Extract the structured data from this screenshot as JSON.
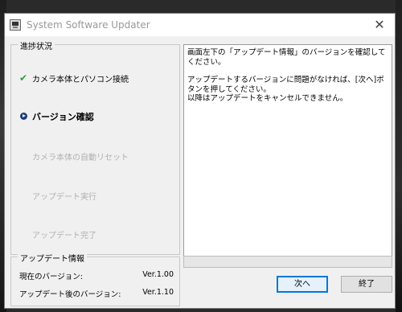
{
  "window": {
    "title": "System Software Updater",
    "close_glyph": "✕"
  },
  "progress_panel": {
    "legend": "進捗状況",
    "steps": [
      {
        "label": "カメラ本体とパソコン接続",
        "state": "done",
        "icon": "check-icon"
      },
      {
        "label": "バージョン確認",
        "state": "current",
        "icon": "arrow-icon"
      },
      {
        "label": "カメラ本体の自動リセット",
        "state": "pending"
      },
      {
        "label": "アップデート実行",
        "state": "pending"
      },
      {
        "label": "アップデート完了",
        "state": "pending"
      }
    ]
  },
  "message": {
    "line1": "画面左下の「アップデート情報」のバージョンを確認してください。",
    "line2": "アップデートするバージョンに問題がなければ、[次へ]ボタンを押してください。",
    "line3": "以降はアップデートをキャンセルできません。"
  },
  "update_info": {
    "legend": "アップデート情報",
    "current_label": "現在のバージョン:",
    "current_value": "Ver.1.00",
    "after_label": "アップデート後のバージョン:",
    "after_value": "Ver.1.10"
  },
  "progress_bar": {
    "value": 0
  },
  "buttons": {
    "next": "次へ",
    "exit": "終了"
  },
  "colors": {
    "check": "#2e9e3a",
    "current_arrow": "#1a3d7c",
    "pending_text": "#b0b0b0",
    "default_button_border": "#0078d7"
  }
}
